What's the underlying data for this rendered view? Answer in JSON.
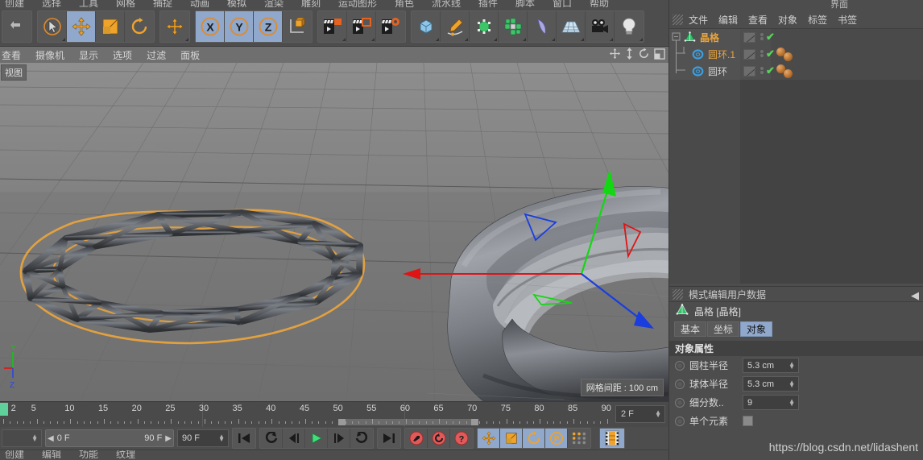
{
  "app": {
    "top_menu": [
      "创建",
      "选择",
      "工具",
      "网格",
      "捕捉",
      "动画",
      "模拟",
      "渲染",
      "雕刻",
      "运动图形",
      "角色",
      "流水线",
      "插件",
      "脚本",
      "窗口",
      "帮助"
    ],
    "watermark": "https://blog.csdn.net/lidashent"
  },
  "toolbar": {
    "groups": [
      {
        "name": "undo-group",
        "buttons": [
          {
            "icon": "undo-icon",
            "label": "撤销",
            "active": false
          }
        ]
      },
      {
        "name": "transform-group",
        "buttons": [
          {
            "icon": "live-selection-icon",
            "label": "实时选择",
            "active": false
          },
          {
            "icon": "move-icon",
            "label": "移动",
            "active": true
          },
          {
            "icon": "scale-icon",
            "label": "缩放",
            "active": false
          },
          {
            "icon": "rotate-icon",
            "label": "旋转",
            "active": false
          }
        ]
      },
      {
        "name": "world-group",
        "buttons": [
          {
            "icon": "world-axis-icon",
            "label": "坐标系统",
            "active": false
          }
        ]
      },
      {
        "name": "axis-lock-group",
        "buttons": [
          {
            "icon": "x-axis-icon",
            "label": "X",
            "active": true
          },
          {
            "icon": "y-axis-icon",
            "label": "Y",
            "active": true
          },
          {
            "icon": "z-axis-icon",
            "label": "Z",
            "active": true
          },
          {
            "icon": "object-axis-icon",
            "label": "对象坐标",
            "active": false
          }
        ]
      },
      {
        "name": "render-group",
        "buttons": [
          {
            "icon": "render-view-icon",
            "label": "渲染当前视图",
            "active": false
          },
          {
            "icon": "render-region-icon",
            "label": "渲染到图片查看器",
            "active": false
          },
          {
            "icon": "render-settings-icon",
            "label": "编辑渲染设置",
            "active": false
          }
        ]
      },
      {
        "name": "create-group",
        "buttons": [
          {
            "icon": "cube-icon",
            "label": "立方体",
            "active": false
          },
          {
            "icon": "spline-pen-icon",
            "label": "画笔",
            "active": false
          },
          {
            "icon": "nurbs-icon",
            "label": "细分曲面",
            "active": false
          },
          {
            "icon": "mograph-icon",
            "label": "运动图形",
            "active": false
          },
          {
            "icon": "bend-icon",
            "label": "弯曲",
            "active": false
          },
          {
            "icon": "floor-icon",
            "label": "地面",
            "active": false
          },
          {
            "icon": "camera-icon",
            "label": "摄像机",
            "active": false
          },
          {
            "icon": "light-icon",
            "label": "灯光",
            "active": false
          }
        ]
      }
    ]
  },
  "viewport": {
    "menu": [
      "查看",
      "摄像机",
      "显示",
      "选项",
      "过滤",
      "面板"
    ],
    "view_label": "视图",
    "grid_info": "网格间距 : 100 cm",
    "nav_icons": [
      "pan-icon",
      "zoom-icon",
      "orbit-icon",
      "maximize-icon"
    ],
    "axis_corner": {
      "y_label": "Y",
      "z_label": "Z"
    }
  },
  "timeline": {
    "ticks": [
      2,
      5,
      10,
      15,
      20,
      25,
      30,
      35,
      40,
      45,
      50,
      55,
      60,
      65,
      70,
      75,
      80,
      85,
      90
    ],
    "current_frame_field": "2 F"
  },
  "playback": {
    "range_start": "0 F",
    "range_end": "90 F",
    "end_field": "90 F",
    "buttons": [
      {
        "icon": "go-to-start-icon",
        "label": "转到开始"
      },
      {
        "icon": "step-back-key-icon",
        "label": "转到上一关键帧"
      },
      {
        "icon": "step-back-icon",
        "label": "转到上一帧"
      },
      {
        "icon": "play-icon",
        "label": "向前播放"
      },
      {
        "icon": "step-forward-icon",
        "label": "转到下一帧"
      },
      {
        "icon": "step-forward-key-icon",
        "label": "转到下一关键帧"
      },
      {
        "icon": "go-to-end-icon",
        "label": "转到结束"
      }
    ],
    "record_buttons": [
      {
        "icon": "record-key-icon",
        "label": "记录活动对象"
      },
      {
        "icon": "autokey-icon",
        "label": "自动关键帧"
      },
      {
        "icon": "keyframe-selection-icon",
        "label": "关键帧选集"
      }
    ],
    "param_buttons": [
      {
        "icon": "position-key-icon",
        "label": "位置",
        "active": true
      },
      {
        "icon": "scale-key-icon",
        "label": "缩放",
        "active": true
      },
      {
        "icon": "rotation-key-icon",
        "label": "旋转",
        "active": true
      },
      {
        "icon": "pla-key-icon",
        "label": "参数级别动画",
        "active": true
      },
      {
        "icon": "point-level-icon",
        "label": "点级别动画",
        "active": false
      }
    ],
    "filmstrip_icon": "timeline-icon"
  },
  "status_bar": [
    "创建",
    "编辑",
    "功能",
    "纹理"
  ],
  "object_manager": {
    "menu": [
      "文件",
      "编辑",
      "查看",
      "对象",
      "标签",
      "书签"
    ],
    "rows": [
      {
        "name": "晶格",
        "icon": "atom-array-icon",
        "color": "#e8a33d",
        "depth": 0,
        "tags": 0,
        "selected": true
      },
      {
        "name": "圆环.1",
        "icon": "torus-icon",
        "color": "#e8a33d",
        "depth": 1,
        "tags": 2,
        "selected": false
      },
      {
        "name": "圆环",
        "icon": "torus-icon",
        "color": "#d0d0d0",
        "depth": 1,
        "tags": 2,
        "selected": false
      }
    ]
  },
  "attribute_manager": {
    "menu": [
      "模式",
      "编辑",
      "用户数据"
    ],
    "object_title": "晶格 [晶格]",
    "object_icon": "atom-array-icon",
    "tabs": [
      {
        "label": "基本",
        "selected": false
      },
      {
        "label": "坐标",
        "selected": false
      },
      {
        "label": "对象",
        "selected": true
      }
    ],
    "section_title": "对象属性",
    "properties": [
      {
        "label": "圆柱半径",
        "value": "5.3 cm",
        "type": "number"
      },
      {
        "label": "球体半径",
        "value": "5.3 cm",
        "type": "number"
      },
      {
        "label": "细分数..",
        "value": "9",
        "type": "number"
      },
      {
        "label": "单个元素",
        "value": "",
        "type": "checkbox"
      }
    ]
  },
  "colors": {
    "accent": "#8fa8cc",
    "selection_orange": "#e8a33d",
    "panel_bg": "#4d4d4d",
    "annotation_red": "#ff2222"
  }
}
